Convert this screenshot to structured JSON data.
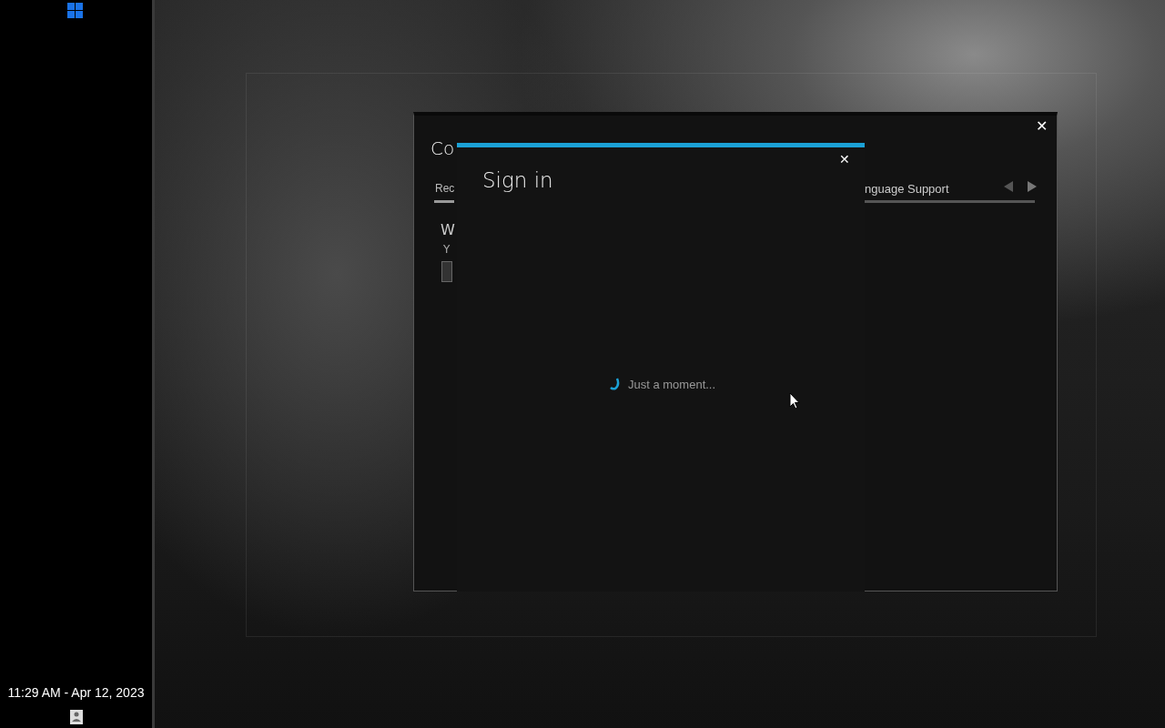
{
  "taskbar": {
    "clock": "11:29 AM - Apr 12, 2023"
  },
  "close_buttons": [
    "✕",
    "✕"
  ],
  "window": {
    "title": "Co",
    "tabs": [
      {
        "label": "Rec",
        "selected": true
      },
      {
        "label": "nguage Support",
        "selected": false
      }
    ],
    "heading": "W",
    "subtext": "Y"
  },
  "dialog": {
    "title": "Sign in",
    "message": "Just a moment..."
  }
}
